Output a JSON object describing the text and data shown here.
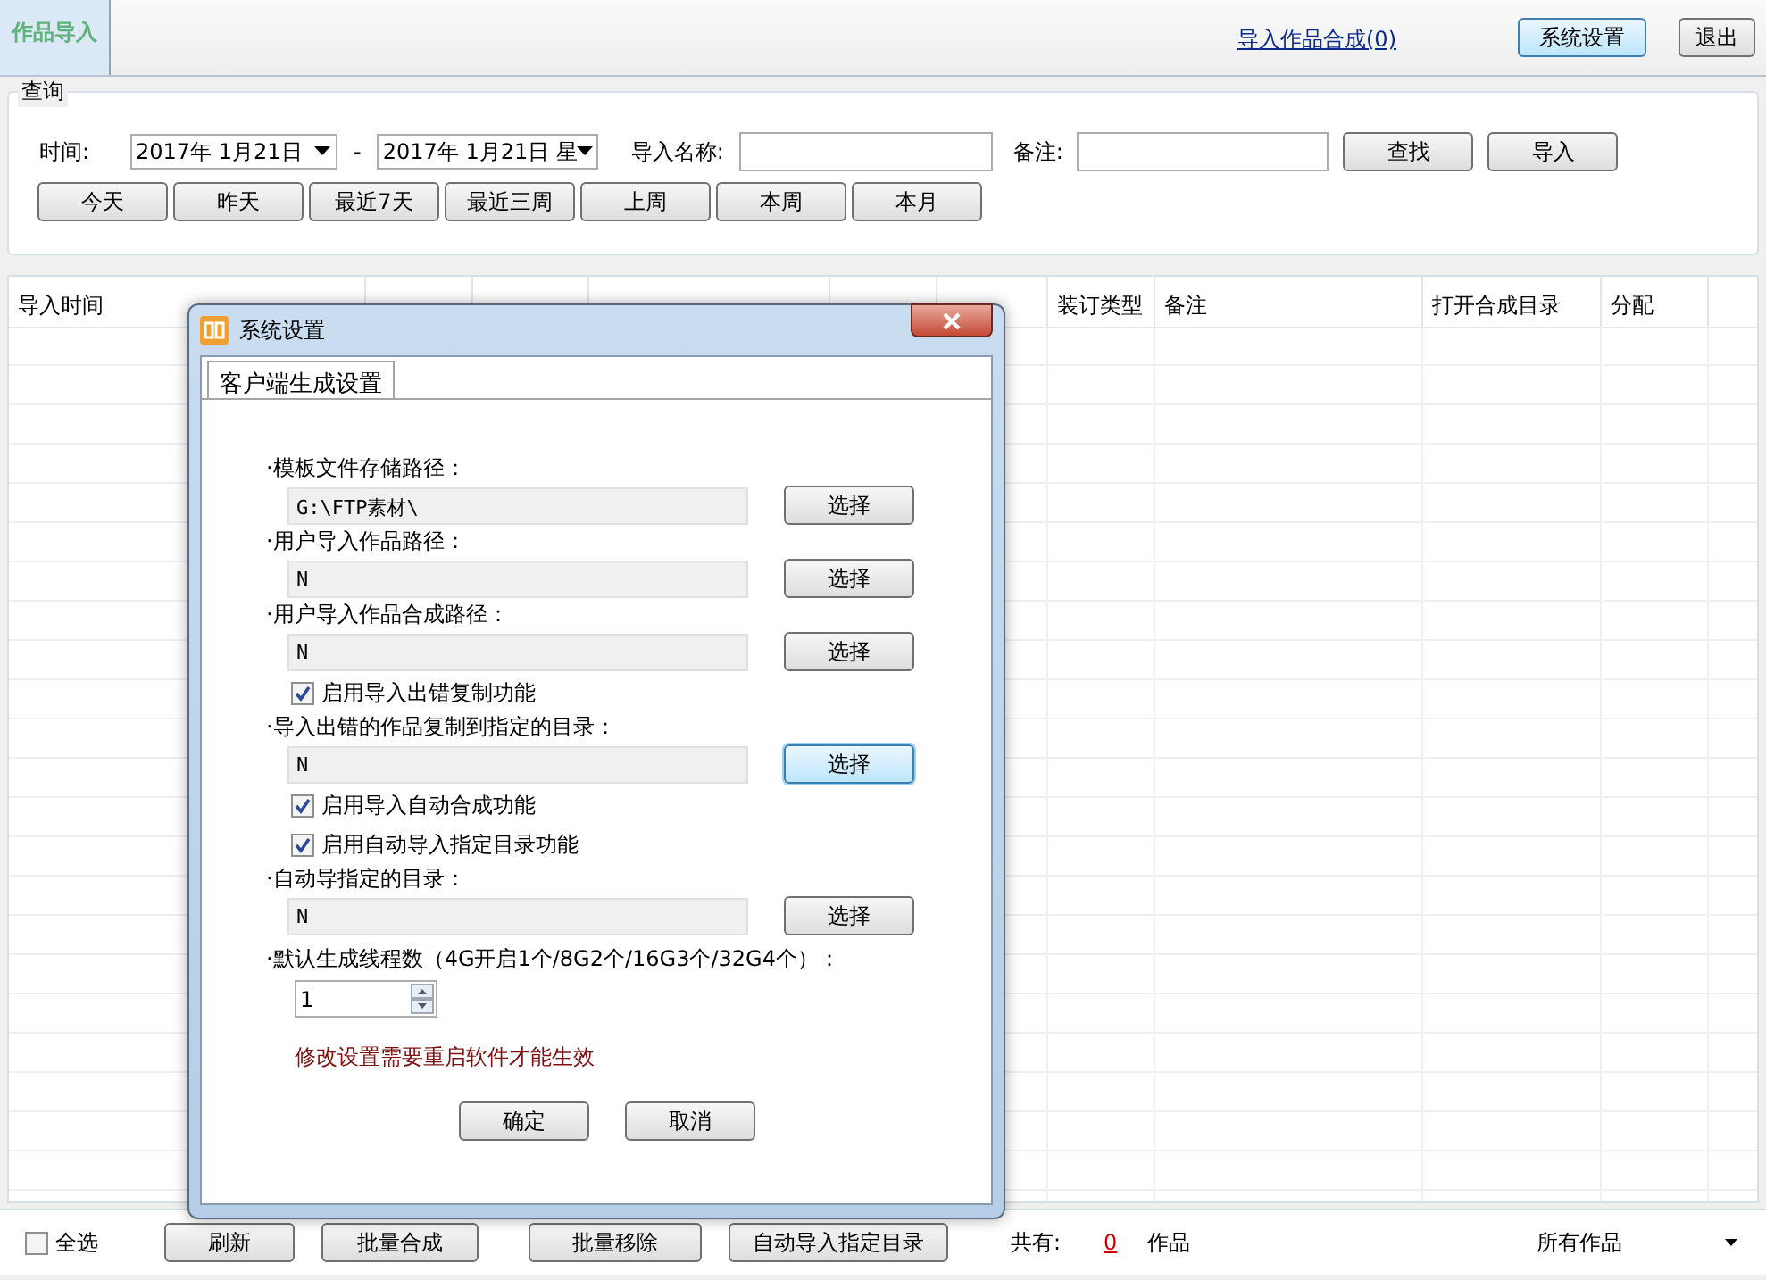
{
  "top_bar": {
    "tab": {
      "label": "作品导入",
      "selected": true
    },
    "link": "导入作品合成(0)",
    "buttons": [
      "系统设置",
      "退出"
    ]
  },
  "query": {
    "title": "查询",
    "time_label": "时间:",
    "date_from": "2017年 1月21日",
    "separator": "-",
    "date_to": "2017年 1月21日 星",
    "name_label": "导入名称:",
    "note_label": "备注:",
    "actions": [
      "查找",
      "导入"
    ],
    "ranges": [
      "今天",
      "昨天",
      "最近7天",
      "最近三周",
      "上周",
      "本周",
      "本月"
    ]
  },
  "table": {
    "columns": [
      "导入时间",
      "装订类型",
      "备注",
      "打开合成目录",
      "分配"
    ]
  },
  "footer": {
    "select_all": {
      "label": "全选",
      "checked": false
    },
    "buttons": [
      "刷新",
      "批量合成",
      "批量移除",
      "自动导入指定目录"
    ],
    "total_label": "共有:",
    "total": "0",
    "unit": "作品",
    "filter": "所有作品"
  },
  "dialog": {
    "title": "系统设置",
    "tab": {
      "label": "客户端生成设置",
      "selected": true
    },
    "items": [
      {
        "kind": "path",
        "label": "·模板文件存储路径：",
        "value": "G:\\FTP素材\\",
        "button": "选择",
        "focused": false
      },
      {
        "kind": "path",
        "label": "·用户导入作品路径：",
        "value": "N",
        "button": "选择",
        "focused": false
      },
      {
        "kind": "path",
        "label": "·用户导入作品合成路径：",
        "value": "N",
        "button": "选择",
        "focused": false
      },
      {
        "kind": "checkbox",
        "label": "启用导入出错复制功能",
        "checked": true
      },
      {
        "kind": "path",
        "label": "·导入出错的作品复制到指定的目录：",
        "value": "N",
        "button": "选择",
        "focused": true
      },
      {
        "kind": "checkbox",
        "label": "启用导入自动合成功能",
        "checked": true
      },
      {
        "kind": "checkbox",
        "label": "启用自动导入指定目录功能",
        "checked": true
      },
      {
        "kind": "path",
        "label": "·自动导指定的目录：",
        "value": "N",
        "button": "选择",
        "focused": false
      },
      {
        "kind": "spinner",
        "label": "·默认生成线程数（4G开启1个/8G2个/16G3个/32G4个）：",
        "value": "1"
      }
    ],
    "notice": "修改设置需要重启软件才能生效",
    "buttons": [
      "确定",
      "取消"
    ]
  }
}
